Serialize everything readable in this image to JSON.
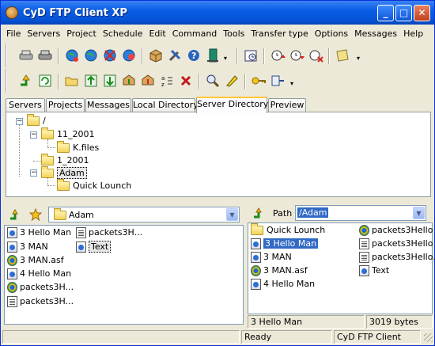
{
  "window": {
    "title": "CyD FTP Client XP",
    "minimize_label": "_",
    "maximize_label": "□",
    "close_label": "✕"
  },
  "menu": [
    "File",
    "Servers",
    "Project",
    "Schedule",
    "Edit",
    "Command",
    "Tools",
    "Transfer type",
    "Options",
    "Messages",
    "Help"
  ],
  "tabs": [
    "Servers",
    "Projects",
    "Messages",
    "Local Directory",
    "Server Directory",
    "Preview"
  ],
  "active_tab": "Server Directory",
  "tree": {
    "root": "/",
    "items": [
      {
        "label": "11_2001",
        "expanded": true,
        "children": [
          "K.files"
        ]
      },
      {
        "label": "1_2001"
      },
      {
        "label": "Adam",
        "expanded": true,
        "selected": true,
        "children": [
          "Quick Lounch"
        ]
      }
    ]
  },
  "local_panel": {
    "path": "Adam",
    "files_col1": [
      "3 Hello Man",
      "3 MAN",
      "3 MAN.asf",
      "4 Hello Man",
      "packets3H...",
      "packets3H..."
    ],
    "files_col2": [
      "packets3H...",
      "Text"
    ],
    "selected": "Text"
  },
  "remote_panel": {
    "path_label": "Path",
    "path_value": "/Adam",
    "files_col1": [
      "Quick Lounch",
      "3 Hello Man",
      "3 MAN",
      "3 MAN.asf",
      "4 Hello Man"
    ],
    "files_col2": [
      "packets3Hello",
      "packets3Hello",
      "packets3Hello.",
      "Text"
    ],
    "selected": "3 Hello Man",
    "status_name": "3 Hello Man",
    "status_size": "3019 bytes"
  },
  "statusbar": {
    "ready": "Ready",
    "app": "CyD FTP Client"
  },
  "colors": {
    "titlebar": "#0a5fe6",
    "selection": "#316ac5",
    "face": "#ece9d8",
    "active_tab_accent": "#ffc83c"
  }
}
